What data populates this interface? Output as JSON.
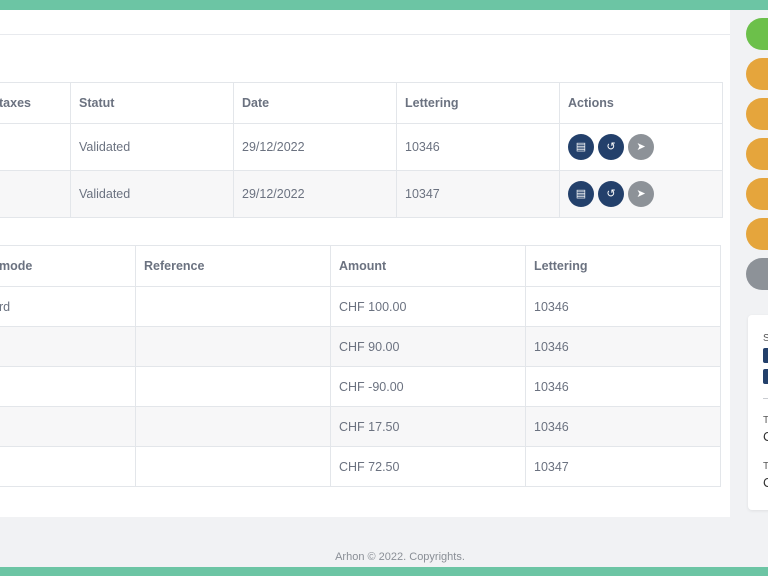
{
  "invoices": {
    "headers": [
      "taxes",
      "Statut",
      "Date",
      "Lettering",
      "Actions"
    ],
    "rows": [
      {
        "taxes": "",
        "status": "Validated",
        "date": "29/12/2022",
        "lettering": "10346"
      },
      {
        "taxes": "",
        "status": "Validated",
        "date": "29/12/2022",
        "lettering": "10347"
      }
    ],
    "action_icons": [
      "document-icon",
      "undo-icon",
      "send-icon"
    ]
  },
  "payments": {
    "headers": [
      "mode",
      "Reference",
      "Amount",
      "Lettering"
    ],
    "rows": [
      {
        "mode": "rd",
        "reference": "",
        "amount": "CHF 100.00",
        "lettering": "10346"
      },
      {
        "mode": "",
        "reference": "",
        "amount": "CHF 90.00",
        "lettering": "10346"
      },
      {
        "mode": "",
        "reference": "",
        "amount": "CHF -90.00",
        "lettering": "10346"
      },
      {
        "mode": "",
        "reference": "",
        "amount": "CHF 17.50",
        "lettering": "10346"
      },
      {
        "mode": "",
        "reference": "",
        "amount": "CHF 72.50",
        "lettering": "10347"
      }
    ]
  },
  "footer": {
    "text": "Arhon © 2022. Copyrights."
  },
  "sidebar": {
    "card": {
      "frag1": "S",
      "frag2": "T",
      "frag3": "C",
      "frag4": "T",
      "frag5": "C"
    }
  },
  "colors": {
    "accent": "#6cc5a4",
    "green": "#6cc04a",
    "orange": "#e5a53c",
    "grey": "#8d9298",
    "navy": "#23406b"
  }
}
